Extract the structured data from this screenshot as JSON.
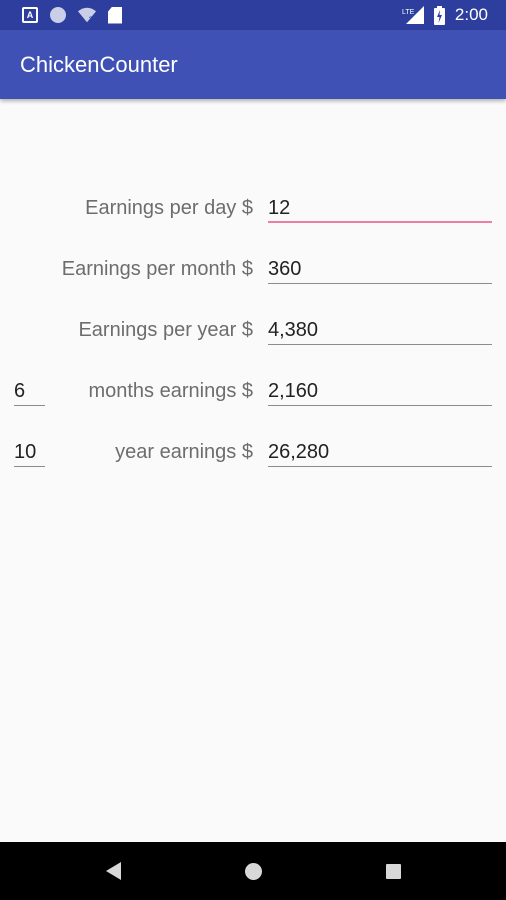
{
  "status_bar": {
    "time": "2:00",
    "network": "LTE",
    "icons": [
      "a-notification-icon",
      "circle-notification-icon",
      "wifi-question-icon",
      "sd-card-icon",
      "lte-signal-icon",
      "battery-charging-icon"
    ]
  },
  "app_bar": {
    "title": "ChickenCounter",
    "color": "#3f51b5"
  },
  "rows": [
    {
      "label": "Earnings per day $",
      "value": "12"
    },
    {
      "label": "Earnings per month $",
      "value": "360"
    },
    {
      "label": "Earnings per year $",
      "value": "4,380"
    },
    {
      "label": "months earnings $",
      "value": "2,160",
      "count": "6"
    },
    {
      "label": "year earnings $",
      "value": "26,280",
      "count": "10"
    }
  ],
  "colors": {
    "status_bar": "#2e3e9e",
    "focus_underline": "#ef7fa0"
  },
  "nav_bar": {
    "icons": [
      "back-icon",
      "home-icon",
      "recents-icon"
    ]
  }
}
